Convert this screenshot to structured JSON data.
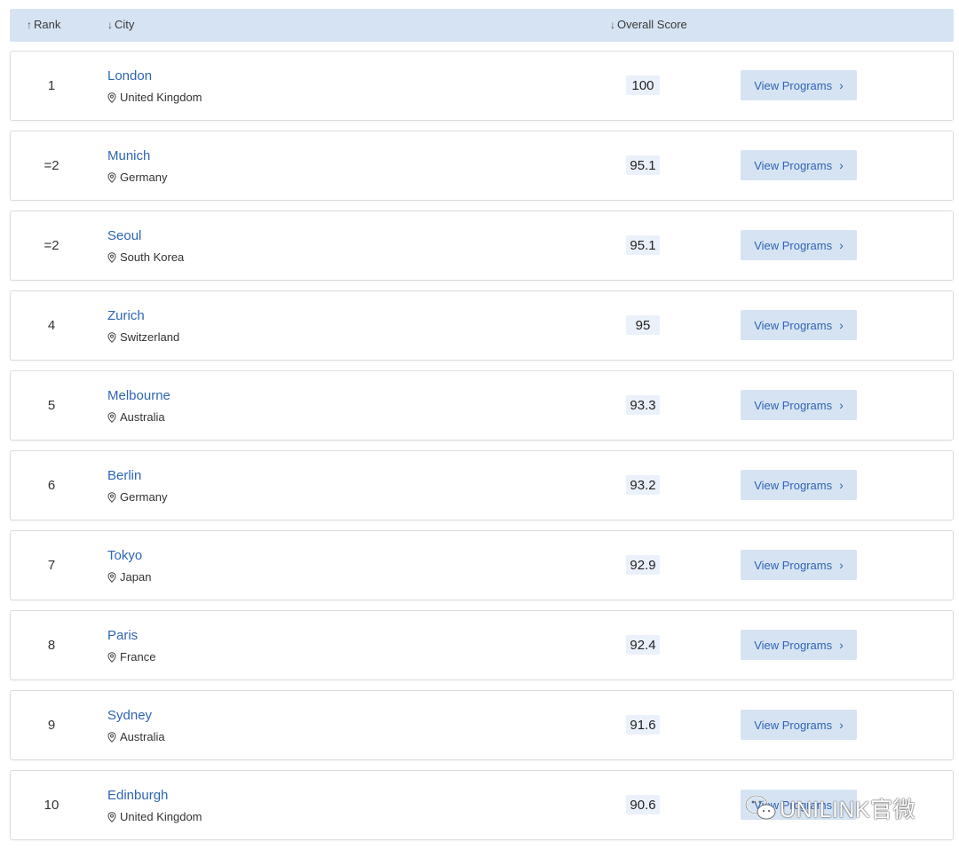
{
  "header": {
    "rank_label": "Rank",
    "city_label": "City",
    "score_label": "Overall Score",
    "rank_sort_icon": "arrow-up-icon",
    "city_sort_icon": "arrow-down-icon",
    "score_sort_icon": "arrow-down-icon"
  },
  "button_label": "View Programs",
  "rows": [
    {
      "rank": "1",
      "city": "London",
      "country": "United Kingdom",
      "score": "100"
    },
    {
      "rank": "=2",
      "city": "Munich",
      "country": "Germany",
      "score": "95.1"
    },
    {
      "rank": "=2",
      "city": "Seoul",
      "country": "South Korea",
      "score": "95.1"
    },
    {
      "rank": "4",
      "city": "Zurich",
      "country": "Switzerland",
      "score": "95"
    },
    {
      "rank": "5",
      "city": "Melbourne",
      "country": "Australia",
      "score": "93.3"
    },
    {
      "rank": "6",
      "city": "Berlin",
      "country": "Germany",
      "score": "93.2"
    },
    {
      "rank": "7",
      "city": "Tokyo",
      "country": "Japan",
      "score": "92.9"
    },
    {
      "rank": "8",
      "city": "Paris",
      "country": "France",
      "score": "92.4"
    },
    {
      "rank": "9",
      "city": "Sydney",
      "country": "Australia",
      "score": "91.6"
    },
    {
      "rank": "10",
      "city": "Edinburgh",
      "country": "United Kingdom",
      "score": "90.6"
    }
  ],
  "watermark": {
    "text": "UNILINK官微",
    "icon": "wechat-icon"
  },
  "colors": {
    "accent": "#2f65b4",
    "header_bg": "#d6e3f3",
    "score_bg": "#eaf1fa"
  }
}
